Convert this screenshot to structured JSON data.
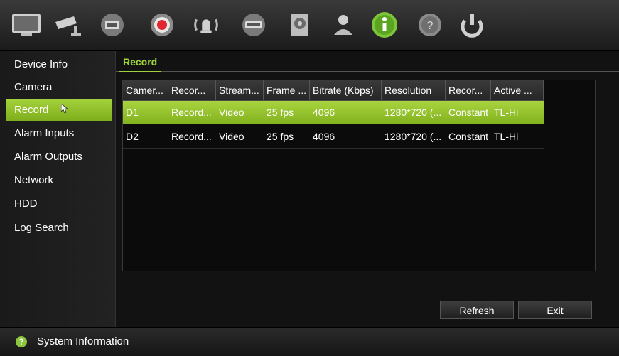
{
  "toolbar": {
    "icons": [
      "monitor-icon",
      "camera-icon",
      "network-icon",
      "record-icon",
      "alarm-icon",
      "video-icon",
      "disk-icon",
      "user-icon",
      "info-icon",
      "help-icon",
      "power-icon"
    ],
    "accent_active": "#8cc63f"
  },
  "sidebar": {
    "items": [
      {
        "label": "Device Info"
      },
      {
        "label": "Camera"
      },
      {
        "label": "Record"
      },
      {
        "label": "Alarm Inputs"
      },
      {
        "label": "Alarm Outputs"
      },
      {
        "label": "Network"
      },
      {
        "label": "HDD"
      },
      {
        "label": "Log Search"
      }
    ],
    "active_index": 2
  },
  "main": {
    "tab_label": "Record",
    "table": {
      "headers": [
        "Camer...",
        "Recor...",
        "Stream...",
        "Frame ...",
        "Bitrate (Kbps)",
        "Resolution",
        "Recor...",
        "Active ..."
      ],
      "rows": [
        {
          "camera": "D1",
          "record": "Record...",
          "stream": "Video",
          "frame": "25 fps",
          "bitrate": "4096",
          "resolution": "1280*720 (...",
          "rec_mode": "Constant",
          "active": "TL-Hi"
        },
        {
          "camera": "D2",
          "record": "Record...",
          "stream": "Video",
          "frame": "25 fps",
          "bitrate": "4096",
          "resolution": "1280*720 (...",
          "rec_mode": "Constant",
          "active": "TL-Hi"
        }
      ],
      "selected_row": 0
    },
    "buttons": {
      "refresh": "Refresh",
      "exit": "Exit"
    }
  },
  "statusbar": {
    "icon": "help-circle-icon",
    "text": "System Information"
  },
  "colors": {
    "accent": "#8cc63f",
    "background": "#000000"
  }
}
